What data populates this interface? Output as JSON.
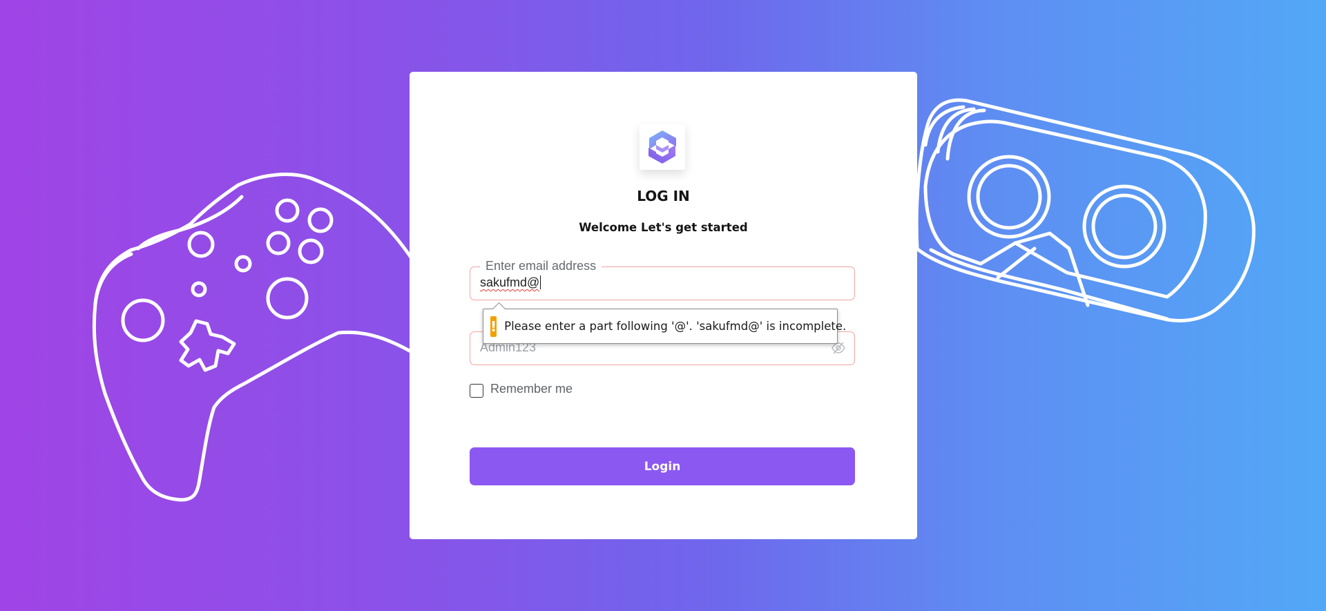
{
  "page": {
    "background_colors": [
      "#a044e6",
      "#6f66ec",
      "#52a8f7"
    ]
  },
  "login_card": {
    "logo_icon": "hexagon-logo-icon",
    "title": "LOG IN",
    "subtitle": "Welcome Let's get started"
  },
  "email_field": {
    "label": "Enter email address",
    "value": "sakufmd@",
    "error_border_color": "#f1a3a3"
  },
  "validation_tooltip": {
    "icon": "warning-icon",
    "icon_color": "#f2a000",
    "message": "Please enter a part following '@'. 'sakufmd@' is incomplete."
  },
  "password_field": {
    "placeholder": "Admin123",
    "toggle_icon": "eye-slash-icon"
  },
  "remember_me": {
    "label": "Remember me",
    "checked": false
  },
  "login_button": {
    "label": "Login",
    "color": "#8c58f2"
  },
  "decorations": {
    "left_icon": "gamepad-outline-icon",
    "right_icon": "vr-headset-outline-icon"
  }
}
